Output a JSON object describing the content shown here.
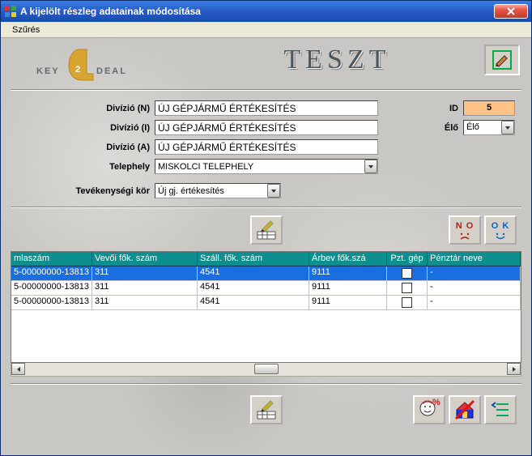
{
  "window": {
    "title": "A kijelölt részleg adatainak módosítása"
  },
  "menu": {
    "filter": "Szűrés"
  },
  "logo": {
    "brand_left": "KEY",
    "brand_right": "DEAL",
    "accent_digit": "2"
  },
  "header": {
    "banner": "TESZT"
  },
  "form": {
    "labels": {
      "div_n": "Divízió (N)",
      "div_i": "Divízió (I)",
      "div_a": "Divízió (A)",
      "telephely": "Telephely",
      "tevekenyseg": "Tevékenységi kör",
      "id": "ID",
      "elo": "Élő"
    },
    "values": {
      "div_n": "ÚJ GÉPJÁRMŰ ÉRTÉKESÍTÉS",
      "div_i": "ÚJ GÉPJÁRMŰ ÉRTÉKESÍTÉS",
      "div_a": "ÚJ GÉPJÁRMŰ ÉRTÉKESÍTÉS",
      "telephely": "MISKOLCI TELEPHELY",
      "tevekenyseg": "Új gj. értékesítés",
      "id": "5",
      "elo": "Élő"
    }
  },
  "buttons": {
    "no": "N O",
    "ok": "O K"
  },
  "table": {
    "headers": [
      "mlaszám",
      "Vevői fők. szám",
      "Száll. fők. szám",
      "Árbev fők.szá",
      "Pzt. gép",
      "Pénztár neve"
    ],
    "rows": [
      {
        "selected": true,
        "mlaszam": "5-00000000-13813",
        "vevo": "311",
        "szall": "4541",
        "arbev": "9111",
        "pzt": false,
        "penztar": "-"
      },
      {
        "selected": false,
        "mlaszam": "5-00000000-13813",
        "vevo": "311",
        "szall": "4541",
        "arbev": "9111",
        "pzt": false,
        "penztar": "-"
      },
      {
        "selected": false,
        "mlaszam": "5-00000000-13813",
        "vevo": "311",
        "szall": "4541",
        "arbev": "9111",
        "pzt": false,
        "penztar": "-"
      }
    ]
  },
  "colors": {
    "accent_orange": "#ffc385",
    "header_teal": "#0d8f8f",
    "sel_blue": "#1a6fe0"
  }
}
